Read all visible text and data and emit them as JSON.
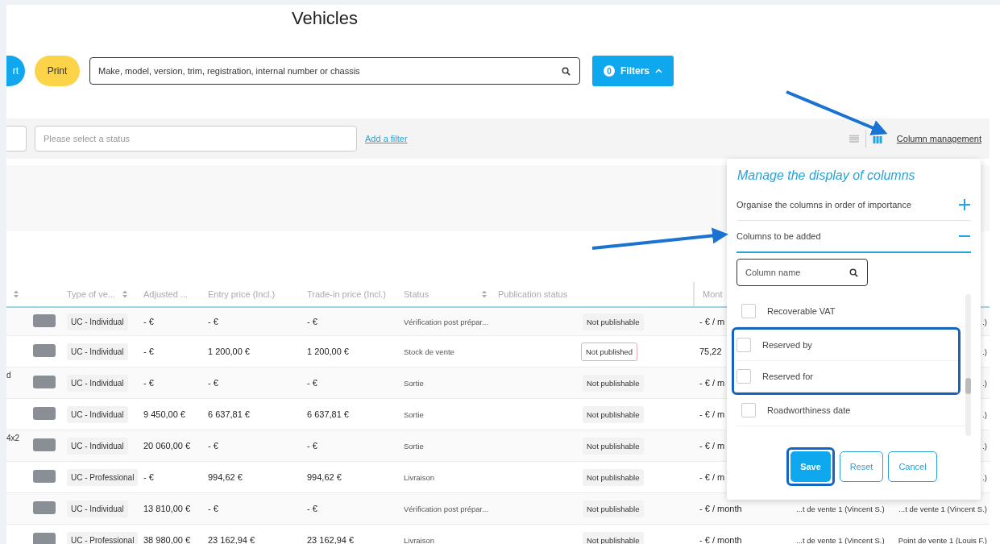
{
  "page_title": "Vehicles",
  "toolbar": {
    "partial_button": "rt",
    "print_button": "Print",
    "search": {
      "placeholder": "Make, model, version, trim, registration, internal number or chassis"
    },
    "filters_button": {
      "count": "0",
      "label": "Filters"
    }
  },
  "filter_bar": {
    "status_field": {
      "placeholder": "Please select a status"
    },
    "add_filter_link": "Add a filter",
    "view_toggle": [
      {
        "kind": "list",
        "selected": false
      },
      {
        "kind": "columns",
        "selected": true
      }
    ],
    "column_management_link": "Column management"
  },
  "table": {
    "columns": [
      {
        "sortable": true
      },
      {
        "label": "Type of ve...",
        "sortable": true
      },
      {
        "label": "Adjusted ...",
        "sortable": false
      },
      {
        "label": "Entry price (Incl.)",
        "sortable": false
      },
      {
        "label": "Trade-in price (Incl.)",
        "sortable": false
      },
      {
        "label": "Status",
        "sortable": true
      },
      {
        "label": "Publication status",
        "sortable": false
      },
      {
        "label": "Mont",
        "sortable": false
      }
    ],
    "rows": [
      {
        "type": "UC - Individual",
        "adjusted": "- €",
        "entry": "- €",
        "trade_in": "- €",
        "status": "Vérification post prépar...",
        "publication": {
          "text": "Not publishable",
          "kind": "tag"
        },
        "monthly": "- € / m",
        "column_11": ".)"
      },
      {
        "type": "UC - Individual",
        "adjusted": "- €",
        "entry": "1 200,00 €",
        "trade_in": "1 200,00 €",
        "status": "Stock de vente",
        "publication": {
          "text": "Not published",
          "kind": "outlined"
        },
        "monthly": "75,22",
        "column_11": ".)"
      },
      {
        "column_1": "d",
        "type": "UC - Individual",
        "adjusted": "- €",
        "entry": "- €",
        "trade_in": "- €",
        "status": "Sortie",
        "publication": {
          "text": "Not publishable",
          "kind": "tag"
        },
        "monthly": "- € / m",
        "column_11": ".)"
      },
      {
        "type": "UC - Individual",
        "adjusted": "9 450,00 €",
        "entry": "6 637,81 €",
        "trade_in": "6 637,81 €",
        "status": "Sortie",
        "publication": {
          "text": "Not publishable",
          "kind": "tag"
        },
        "monthly": "- € / m",
        "column_11": ".)"
      },
      {
        "column_1": "4x2",
        "type": "UC - Individual",
        "adjusted": "20 060,00 €",
        "entry": "- €",
        "trade_in": "- €",
        "status": "Sortie",
        "publication": {
          "text": "Not publishable",
          "kind": "tag"
        },
        "monthly": "- € / m",
        "column_11": ".)"
      },
      {
        "type": "UC - Professional",
        "adjusted": "- €",
        "entry": "994,62 €",
        "trade_in": "994,62 €",
        "status": "Livraison",
        "publication": {
          "text": "Not publishable",
          "kind": "tag"
        },
        "monthly": "- € / m",
        "column_11": ".)"
      },
      {
        "type": "UC - Individual",
        "adjusted": "13 810,00 €",
        "entry": "- €",
        "trade_in": "- €",
        "status": "Vérification post prépar...",
        "publication": {
          "text": "Not publishable",
          "kind": "tag"
        },
        "monthly": "- € / month",
        "column_10": "...t de vente 1 (Vincent S.)",
        "column_11": "...t de vente 1 (Vincent S.)"
      },
      {
        "type": "UC - Professional",
        "adjusted": "38 980,00 €",
        "entry": "23 162,94 €",
        "trade_in": "23 162,94 €",
        "status": "Livraison",
        "publication": {
          "text": "Not publishable",
          "kind": "tag"
        },
        "monthly": "- € / month",
        "column_10": "...t de vente 1 (Vincent S.)",
        "column_11": "Point de vente 1 (Louis F.)"
      }
    ]
  },
  "column_popup": {
    "title": "Manage the display of columns",
    "sections": [
      {
        "label": "Organise the columns in order of importance",
        "expanded": false
      },
      {
        "label": "Columns to be added",
        "expanded": true
      }
    ],
    "search": {
      "placeholder": "Column name"
    },
    "columns": [
      {
        "label": "Recoverable VAT",
        "checked": false
      },
      {
        "label": "Reserved by",
        "checked": false
      },
      {
        "label": "Reserved for",
        "checked": false
      },
      {
        "label": "Roadworthiness date",
        "checked": false
      }
    ],
    "buttons": [
      {
        "label": "Save",
        "kind": "primary"
      },
      {
        "label": "Reset",
        "kind": "secondary"
      },
      {
        "label": "Cancel",
        "kind": "secondary"
      }
    ]
  }
}
